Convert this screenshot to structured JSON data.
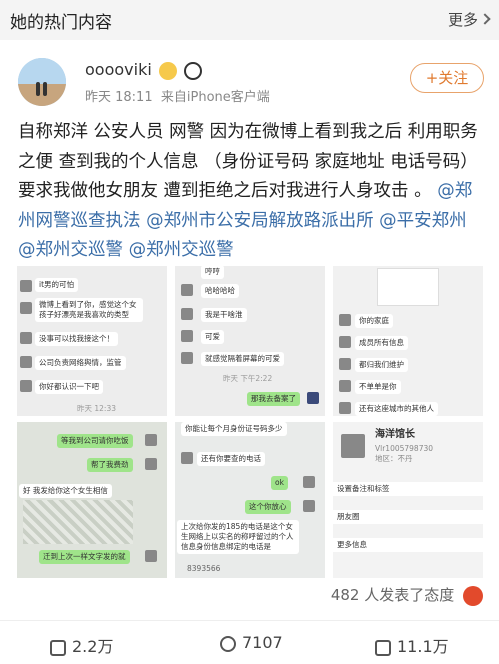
{
  "header": {
    "title": "她的热门内容",
    "more_label": "更多"
  },
  "user": {
    "name": "ooooviki",
    "time": "昨天 18:11",
    "source": "来自iPhone客户端",
    "follow_label": "+关注"
  },
  "post": {
    "text": "自称郑洋 公安人员  网警  因为在微博上看到我之后 利用职务之便 查到我的个人信息  （身份证号码 家庭地址 电话号码）  要求我做他女朋友  遭到拒绝之后对我进行人身攻击 。",
    "mentions": [
      "@郑州网警巡查执法",
      "@郑州市公安局解放路派出所",
      "@平安郑州",
      "@郑州交巡警",
      "@郑州交巡警"
    ]
  },
  "images": {
    "img1": [
      "it男的可怕",
      "微博上看到了你，感觉这个女孩子好漂亮是我喜欢的类型",
      "没事可以找我接这个！",
      "公司负责网络舆情，监管",
      "你好都认识一下吧",
      "昨天 12:33"
    ],
    "img2": [
      "哼哼",
      "哈哈哈哈",
      "我是干啥淮",
      "可爱",
      "就感觉隔着屏幕的可爱",
      "昨天 下午2:22",
      "那我去备案了"
    ],
    "img3": [
      "你的家庭",
      "成员所有信息",
      "都归我们维护",
      "不单单是你",
      "还有这座城市的其他人"
    ],
    "img4": [
      "等我到公司请你吃饭",
      "帮了我费劲",
      "好 我发给你这个女生相信",
      "迁到上次一样文字发的就"
    ],
    "img5": [
      "你能让每个月身份证号码多少",
      "还有你要查的电话",
      "ok",
      "这个你放心",
      "上次给你发的185的电话是这个女生网络上以实名的称呼留过的个人信息身份信息绑定的电话是",
      "8393566"
    ],
    "img6": {
      "name": "海洋馆长",
      "id": "Vlr1005798730",
      "region": "地区：不丹",
      "rows": [
        "设置备注和标签",
        "朋友圈",
        "更多信息"
      ]
    }
  },
  "footer": {
    "attitude": "482 人发表了态度",
    "repost": "2.2万",
    "comment": "7107",
    "like": "11.1万"
  }
}
